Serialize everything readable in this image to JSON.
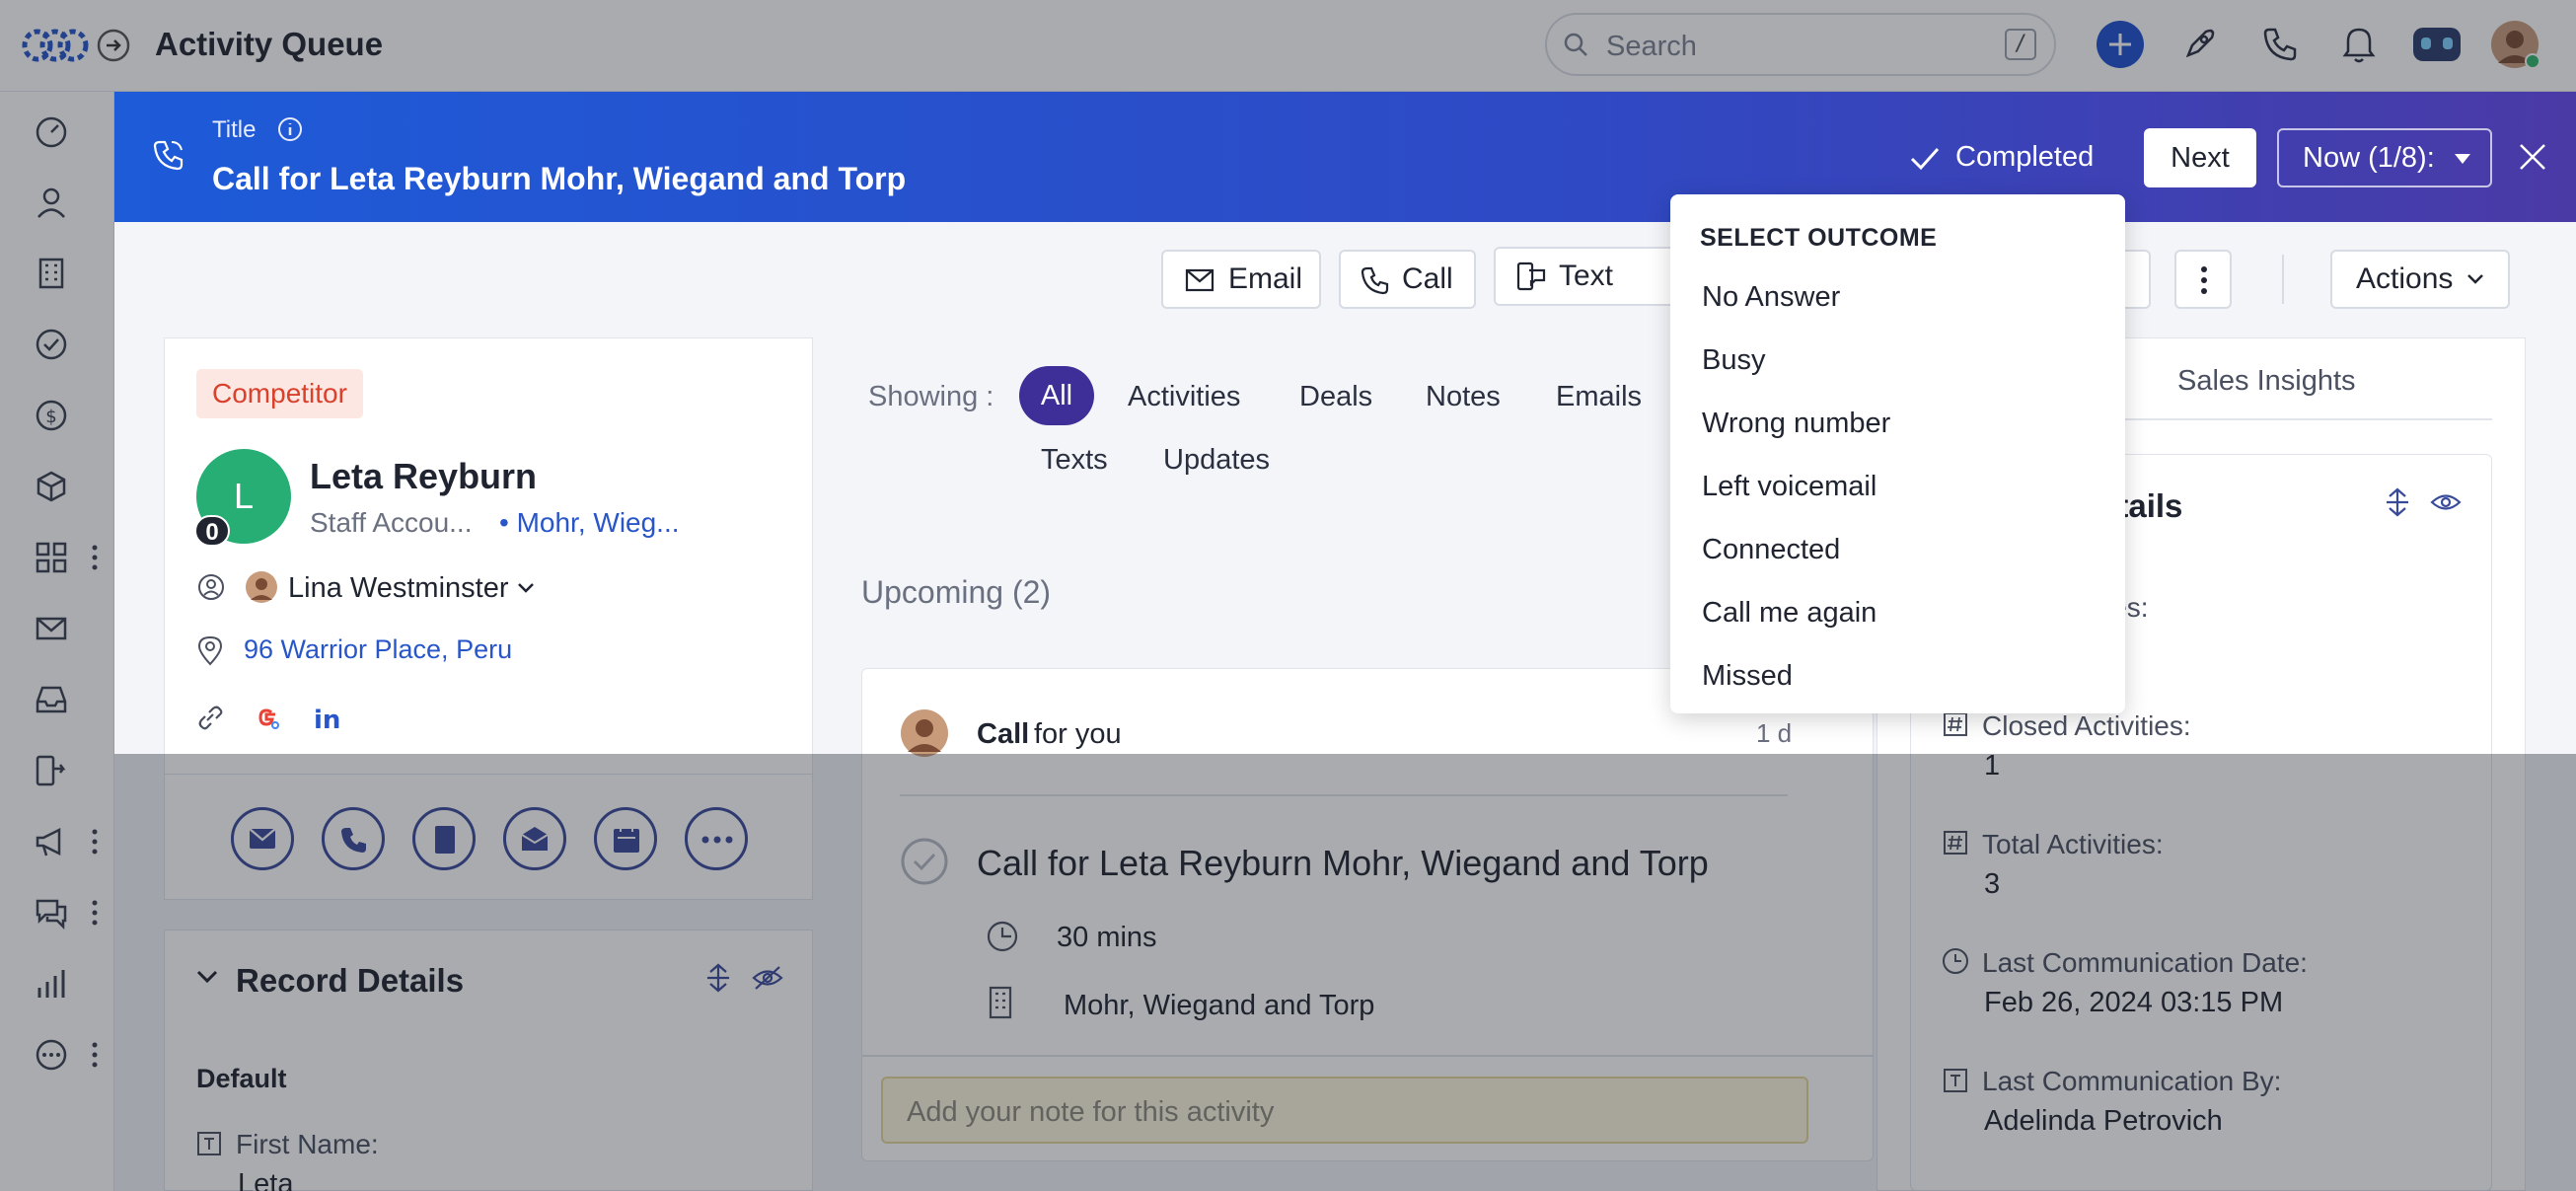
{
  "app": {
    "title": "Activity Queue"
  },
  "search": {
    "placeholder": "Search",
    "shortcut": "/"
  },
  "banner": {
    "title_label": "Title",
    "heading": "Call for Leta Reyburn Mohr, Wiegand and Torp",
    "completed_label": "Completed",
    "next_label": "Next",
    "now_label": "Now (1/8):"
  },
  "toolbar": {
    "email_label": "Email",
    "call_label": "Call",
    "text_label": "Text",
    "actions_label": "Actions"
  },
  "contact": {
    "tag": "Competitor",
    "avatar_letter": "L",
    "badge_count": "0",
    "name": "Leta Reyburn",
    "role": "Staff Accou...",
    "company": "• Mohr, Wieg...",
    "owner": "Lina Westminster",
    "address": "96 Warrior Place, Peru"
  },
  "timeline": {
    "showing_label": "Showing :",
    "filters": [
      "All",
      "Activities",
      "Deals",
      "Notes",
      "Emails",
      "Texts",
      "Updates"
    ],
    "upcoming_label": "Upcoming (2)",
    "item": {
      "type": "Call",
      "suffix": "for you",
      "age": "1 d",
      "title": "Call for Leta Reyburn Mohr, Wiegand and Torp",
      "duration": "30 mins",
      "company": "Mohr, Wiegand and Torp",
      "note_placeholder": "Add your note for this activity"
    }
  },
  "record_details": {
    "title": "Record Details",
    "section": "Default",
    "first_name_label": "First Name:",
    "first_name_value": "Leta"
  },
  "insights": {
    "tab_label": "Sales Insights",
    "details_title_partial": "etails",
    "open_label_partial": "ities:",
    "closed_label": "Closed Activities:",
    "closed_value": "1",
    "total_label": "Total Activities:",
    "total_value": "3",
    "last_comm_date_label": "Last Communication Date:",
    "last_comm_date_value": "Feb 26, 2024 03:15 PM",
    "last_comm_by_label": "Last Communication By:",
    "last_comm_by_value": "Adelinda Petrovich"
  },
  "dropdown": {
    "title": "SELECT OUTCOME",
    "items": [
      "No Answer",
      "Busy",
      "Wrong number",
      "Left voicemail",
      "Connected",
      "Call me again",
      "Missed"
    ]
  },
  "colors": {
    "primary": "#2f49c4",
    "accent": "#3d2f97",
    "tag_bg": "#fde7e3",
    "tag_text": "#d9412b"
  }
}
